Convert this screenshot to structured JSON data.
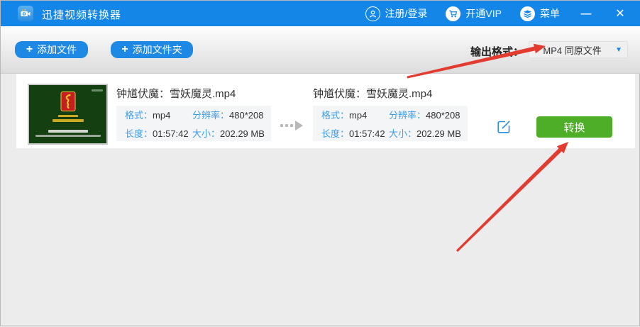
{
  "titlebar": {
    "app_title": "迅捷视频转换器",
    "login_label": "注册/登录",
    "vip_label": "开通VIP",
    "menu_label": "菜单",
    "minimize_icon": "—",
    "close_icon": "✕"
  },
  "toolbar": {
    "plus_icon": "+",
    "add_file_label": "添加文件",
    "add_folder_label": "添加文件夹",
    "output_format_label": "输出格式：",
    "output_format_value": "MP4 同原文件",
    "dropdown_arrow_icon": "▼"
  },
  "file_row": {
    "source": {
      "filename": "钟馗伏魔：雪妖魔灵.mp4",
      "format_label": "格式：",
      "format_value": "mp4",
      "resolution_label": "分辨率：",
      "resolution_value": "480*208",
      "duration_label": "长度：",
      "duration_value": "01:57:42",
      "size_label": "大小：",
      "size_value": "202.29 MB"
    },
    "target": {
      "filename": "钟馗伏魔：雪妖魔灵.mp4",
      "format_label": "格式：",
      "format_value": "mp4",
      "resolution_label": "分辨率：",
      "resolution_value": "480*208",
      "duration_label": "长度：",
      "duration_value": "01:57:42",
      "size_label": "大小：",
      "size_value": "202.29 MB"
    },
    "convert_label": "转换"
  },
  "colors": {
    "titlebar_blue": "#1386e8",
    "accent_blue": "#1e88e5",
    "info_label_blue": "#3f9ce8",
    "convert_green": "#4fae28",
    "arrow_red": "#e23c31",
    "content_bg": "#ececec"
  }
}
